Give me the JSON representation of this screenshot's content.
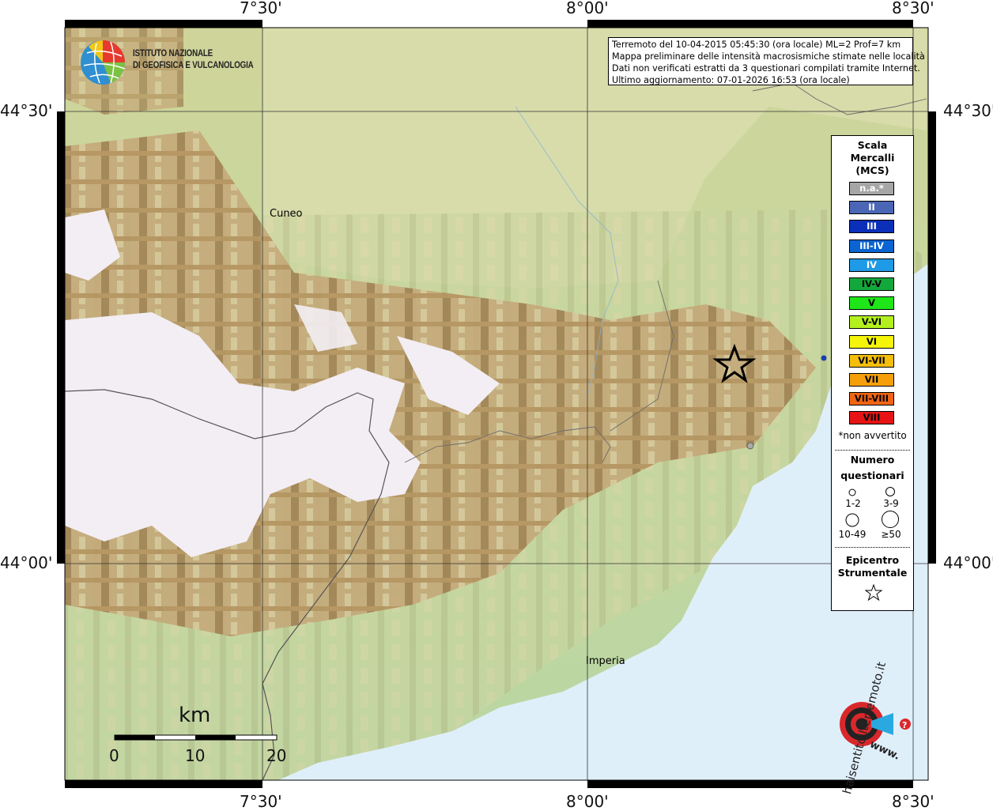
{
  "info": {
    "line1": "Terremoto del 10-04-2015 05:45:30 (ora locale) ML=2 Prof=7 km",
    "line2": "Mappa preliminare delle intensità macrosismiche stimate nelle località",
    "line3": "Dati non verificati estratti da 3 questionari compilati tramite Internet.",
    "line4": "Ultimo aggiornamento: 07-01-2026 16:53 (ora locale)"
  },
  "logo": {
    "line1": "ISTITUTO NAZIONALE",
    "line2": "DI GEOFISICA E VULCANOLOGIA"
  },
  "axes": {
    "lon_top": [
      "7°30'",
      "8°00'",
      "8°30'"
    ],
    "lon_bottom": [
      "7°30'",
      "8°00'",
      "8°30'"
    ],
    "lat_left": [
      "44°30'",
      "44°00'"
    ],
    "lat_right": [
      "44°30'",
      "44°00'"
    ]
  },
  "places": {
    "cuneo": "Cuneo",
    "imperia": "Imperia"
  },
  "scale_bar": {
    "unit": "km",
    "ticks": [
      "0",
      "10",
      "20"
    ]
  },
  "legend": {
    "title_line1": "Scala",
    "title_line2": "Mercalli",
    "title_line3": "(MCS)",
    "classes": [
      {
        "label": "n.a.*",
        "color": "#a6a6a6",
        "text": "#ffffff"
      },
      {
        "label": "II",
        "color": "#4a66b5",
        "text": "#ffffff"
      },
      {
        "label": "III",
        "color": "#0a2fb8",
        "text": "#ffffff"
      },
      {
        "label": "III-IV",
        "color": "#0a64d2",
        "text": "#ffffff"
      },
      {
        "label": "IV",
        "color": "#1e9ae6",
        "text": "#ffffff"
      },
      {
        "label": "IV-V",
        "color": "#13a83b",
        "text": "#000000"
      },
      {
        "label": "V",
        "color": "#1ee619",
        "text": "#000000"
      },
      {
        "label": "V-VI",
        "color": "#b4f01e",
        "text": "#000000"
      },
      {
        "label": "VI",
        "color": "#f5f50a",
        "text": "#000000"
      },
      {
        "label": "VI-VII",
        "color": "#f5be0a",
        "text": "#000000"
      },
      {
        "label": "VII",
        "color": "#f5a00a",
        "text": "#000000"
      },
      {
        "label": "VII-VIII",
        "color": "#f06414",
        "text": "#000000"
      },
      {
        "label": "VIII",
        "color": "#e61414",
        "text": "#000000"
      }
    ],
    "not_felt_note": "*non avvertito",
    "count_title_line1": "Numero",
    "count_title_line2": "questionari",
    "count_sizes": [
      "1-2",
      "3-9",
      "10-49",
      "≥50"
    ],
    "epicenter_line1": "Epicentro",
    "epicenter_line2": "Strumentale"
  },
  "brand": {
    "text": "haisentitoilterremoto.it",
    "sub": "www."
  }
}
